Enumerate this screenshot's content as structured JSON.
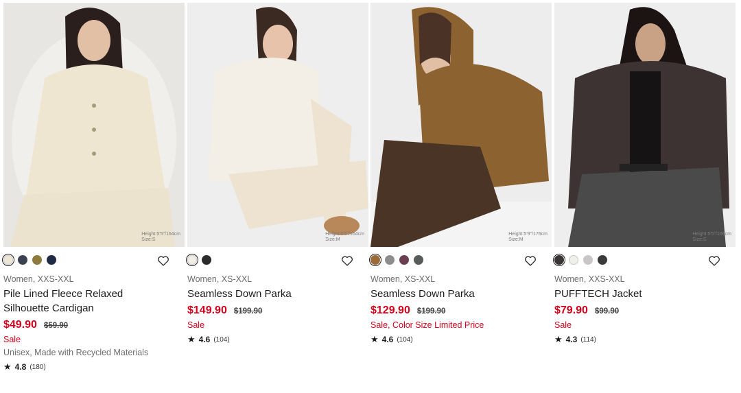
{
  "products": [
    {
      "name": "Pile Lined Fleece Relaxed Silhouette Cardigan",
      "meta": "Women, XXS-XXL",
      "price": "$49.90",
      "orig_price": "$59.90",
      "flag": "Sale",
      "extra": "Unisex, Made with Recycled Materials",
      "rating": "4.8",
      "count": "(180)",
      "overlay": [
        "Height:5'5\"/164cm",
        "Size:S"
      ],
      "swatches": [
        "#efe7d6",
        "#3b4350",
        "#8d7a3c",
        "#1f2a44"
      ],
      "selected": 0,
      "photo": {
        "bg": "#e8e6e3",
        "garment": "#efe6d2",
        "pants": "#ece3cf",
        "hair": "#2a1f1c",
        "skin": "#e2c0a6"
      }
    },
    {
      "name": "Seamless Down Parka",
      "meta": "Women, XS-XXL",
      "price": "$149.90",
      "orig_price": "$199.90",
      "flag": "Sale",
      "extra": "",
      "rating": "4.6",
      "count": "(104)",
      "overlay": [
        "Height:5'5\"/164cm",
        "Size:M"
      ],
      "swatches": [
        "#f2eee5",
        "#2b2b2b"
      ],
      "selected": 0,
      "photo": {
        "bg": "#eeeeee",
        "garment": "#f3efe6",
        "pants": "#ede3d0",
        "hair": "#3a2a22",
        "skin": "#e6c3aa"
      }
    },
    {
      "name": "Seamless Down Parka",
      "meta": "Women, XS-XXL",
      "price": "$129.90",
      "orig_price": "$199.90",
      "flag": "Sale, Color Size Limited Price",
      "extra": "",
      "rating": "4.6",
      "count": "(104)",
      "overlay": [
        "Height:5'9\"/176cm",
        "Size:M"
      ],
      "swatches": [
        "#9a6a38",
        "#8d8d8d",
        "#6a3f52",
        "#575c5a"
      ],
      "selected": 0,
      "photo": {
        "bg": "#ededed",
        "garment": "#8c6230",
        "pants": "#4a3426",
        "hair": "#4a3226",
        "skin": "#e0bfa5"
      }
    },
    {
      "name": "PUFFTECH Jacket",
      "meta": "Women, XXS-XXL",
      "price": "$79.90",
      "orig_price": "$99.90",
      "flag": "Sale",
      "extra": "",
      "rating": "4.3",
      "count": "(114)",
      "overlay": [
        "Height:5'5\"/166cm",
        "Size:S"
      ],
      "swatches": [
        "#3c3535",
        "#f1efe9",
        "#c9c6c8",
        "#3a3a3a"
      ],
      "selected": 0,
      "photo": {
        "bg": "#eeeeee",
        "garment": "#3d3333",
        "pants": "#4a4a4a",
        "hair": "#1c1412",
        "skin": "#c9a184"
      }
    }
  ]
}
